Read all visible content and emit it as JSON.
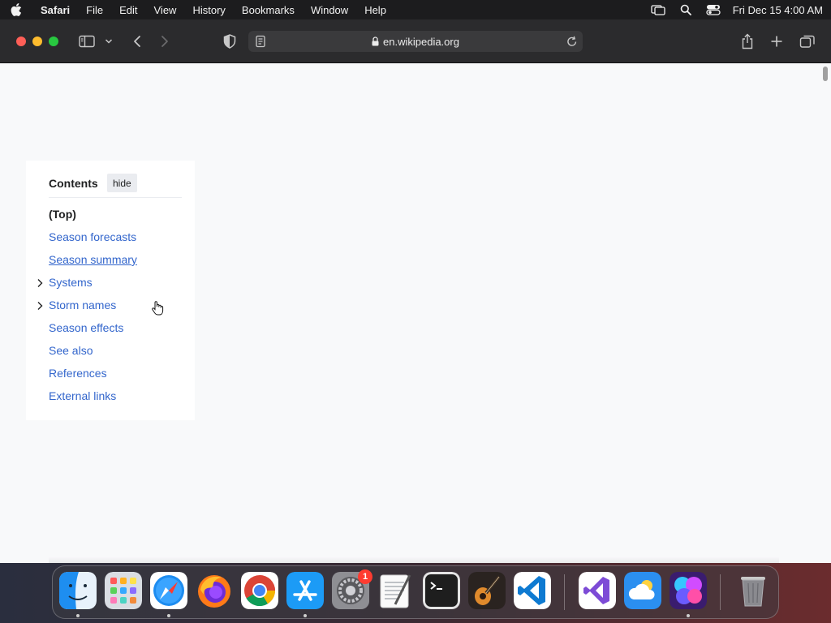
{
  "menubar": {
    "app_name": "Safari",
    "items": [
      "File",
      "Edit",
      "View",
      "History",
      "Bookmarks",
      "Window",
      "Help"
    ],
    "clock": "Fri Dec 15  4:00 AM"
  },
  "browser": {
    "url": "en.wikipedia.org"
  },
  "toc": {
    "title": "Contents",
    "hide_label": "hide",
    "items": [
      {
        "label": "(Top)"
      },
      {
        "label": "Season forecasts"
      },
      {
        "label": "Season summary"
      },
      {
        "label": "Systems"
      },
      {
        "label": "Storm names"
      },
      {
        "label": "Season effects"
      },
      {
        "label": "See also"
      },
      {
        "label": "References"
      },
      {
        "label": "External links"
      }
    ]
  },
  "dock": {
    "apps": [
      "Finder",
      "Launchpad",
      "Safari",
      "Firefox",
      "Chrome",
      "App Store",
      "System Settings",
      "TextEdit",
      "Terminal",
      "GarageBand",
      "Visual Studio Code",
      "Visual Studio",
      "Weather",
      "Figma",
      "Trash"
    ],
    "settings_badge": "1"
  },
  "colors": {
    "link": "#3366cc",
    "menubar_bg": "#1c1c1e",
    "toolbar_bg": "#2b2b2d",
    "page_bg": "#f8f9fa"
  }
}
